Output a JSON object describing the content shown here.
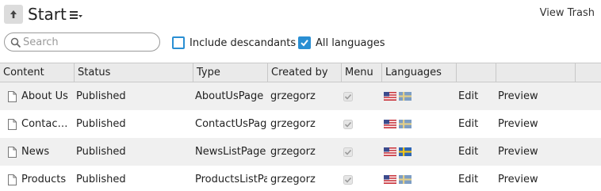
{
  "header": {
    "title": "Start",
    "up_icon": "arrow-up-icon",
    "sort_icon": "sort-menu-icon",
    "view_trash": "View Trash"
  },
  "filters": {
    "search_placeholder": "Search",
    "search_value": "",
    "include_descendants_label": "Include descandants",
    "include_descendants_checked": false,
    "all_languages_label": "All languages",
    "all_languages_checked": true
  },
  "grid": {
    "columns": [
      "Content",
      "Status",
      "Type",
      "Created by",
      "Menu",
      "Languages",
      "",
      ""
    ],
    "rows": [
      {
        "content": "About Us",
        "status": "Published",
        "type": "AboutUsPage",
        "created_by": "grzegorz",
        "menu": true,
        "languages": [
          "en-US",
          "sv-SE"
        ],
        "edit": "Edit",
        "preview": "Preview"
      },
      {
        "content": "Contact Us",
        "status": "Published",
        "type": "ContactUsPage",
        "created_by": "grzegorz",
        "menu": true,
        "languages": [
          "en-US",
          "sv-SE"
        ],
        "edit": "Edit",
        "preview": "Preview"
      },
      {
        "content": "News",
        "status": "Published",
        "type": "NewsListPage",
        "created_by": "grzegorz",
        "menu": true,
        "languages": [
          "en-US",
          "sv-SE"
        ],
        "edit": "Edit",
        "preview": "Preview"
      },
      {
        "content": "Products",
        "status": "Published",
        "type": "ProductsListPage",
        "created_by": "grzegorz",
        "menu": true,
        "languages": [
          "en-US",
          "sv-SE"
        ],
        "edit": "Edit",
        "preview": "Preview"
      }
    ]
  },
  "colors": {
    "accent": "#2a8fd3",
    "header_bg": "#eaeaea",
    "row_alt_bg": "#f0f0f0",
    "border": "#c8c8c8"
  }
}
